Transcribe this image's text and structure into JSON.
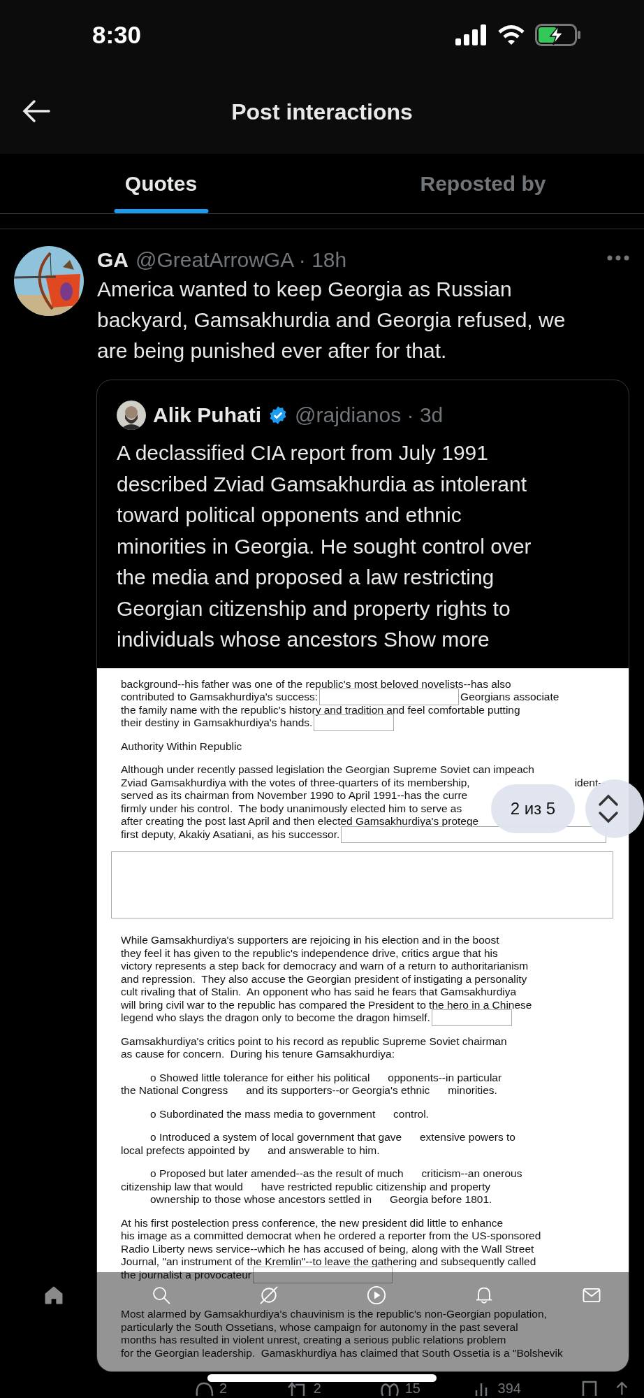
{
  "status_bar": {
    "time": "8:30"
  },
  "header": {
    "title": "Post interactions"
  },
  "tabs": [
    {
      "label": "Quotes",
      "selected": true
    },
    {
      "label": "Reposted by",
      "selected": false
    }
  ],
  "post": {
    "name": "GA",
    "meta": "@GreatArrowGA · 18h",
    "text_lines": [
      "America wanted to keep Georgia as Russian",
      "backyard, Gamsakhurdia and Georgia refused, we",
      "are being punished ever after for that."
    ],
    "quote": {
      "name": "Alik Puhati",
      "verified": true,
      "meta": "@rajdianos · 3d",
      "text_lines": [
        "A declassified CIA report from July 1991",
        "described Zviad Gamsakhurdia as intolerant",
        "toward political opponents and ethnic",
        "minorities in Georgia. He sought control over",
        "the media and proposed a law restricting",
        "Georgian citizenship and property rights to",
        "individuals whose ancestors"
      ],
      "show_more": "Show more",
      "document": {
        "blocks": [
          {
            "kind": "para",
            "lines": [
              {
                "text": "background--his father was one of the republic's most beloved novelists--has also",
                "kind": "plain"
              },
              {
                "text": "contributed to Gamsakhurdiya's success:",
                "kind": "medium",
                "tail": "Georgians associate"
              },
              {
                "text": "the family name with the republic's history and tradition and feel comfortable putting",
                "kind": "plain"
              },
              {
                "text": "their destiny in Gamsakhurdiya's hands.",
                "kind": "short"
              }
            ]
          },
          {
            "kind": "heading",
            "text": "Authority Within Republic"
          },
          {
            "kind": "para",
            "lines": [
              {
                "text": "Although under recently passed legislation the Georgian Supreme Soviet can impeach",
                "kind": "plain"
              },
              {
                "text": "Zviad Gamsakhurdiya with the votes of three-quarters of its membership,",
                "kind": "gap",
                "tail": "ident--"
              },
              {
                "text": "served as its chairman from November 1990 to April 1991--has the curre",
                "kind": "plain"
              },
              {
                "text": "firmly under his control.  The body unanimously elected him to serve as",
                "kind": "plain"
              },
              {
                "text": "after creating the post last April and then elected Gamsakhurdiya's protege",
                "kind": "plain"
              },
              {
                "text": "first deputy, Akakiy Asatiani, as his successor.",
                "kind": "wide"
              }
            ]
          },
          {
            "kind": "redacted_block"
          },
          {
            "kind": "para",
            "lines": [
              {
                "text": "While Gamsakhurdiya's supporters are rejoicing in his election and in the boost",
                "kind": "plain"
              },
              {
                "text": "they feel it has given to the republic's independence drive, critics argue that his",
                "kind": "plain"
              },
              {
                "text": "victory represents a step back for democracy and warn of a return to authoritarianism",
                "kind": "plain"
              },
              {
                "text": "and repression.  They also accuse the Georgian president of instigating a personality",
                "kind": "plain"
              },
              {
                "text": "cult rivaling that of Stalin.  An opponent who has said he fears that Gamsakhurdiya",
                "kind": "plain"
              },
              {
                "text": "will bring civil war to the republic has compared the President to the hero in a Chinese",
                "kind": "plain"
              },
              {
                "text": "legend who slays the dragon only to become the dragon himself.",
                "kind": "short"
              }
            ]
          },
          {
            "kind": "para",
            "lines": [
              {
                "text": "Gamsakhurdiya's critics point to his record as republic Supreme Soviet chairman",
                "kind": "plain"
              },
              {
                "text": "as cause for concern.  During his tenure Gamsakhurdiya:",
                "kind": "plain"
              }
            ]
          },
          {
            "kind": "para",
            "lines": [
              {
                "text": "o Showed little tolerance for either his political      opponents--in particular",
                "kind": "plain",
                "indent": true
              },
              {
                "text": "the National Congress      and its supporters--or Georgia's ethnic      minorities.",
                "kind": "plain",
                "indent": false
              }
            ]
          },
          {
            "kind": "para",
            "lines": [
              {
                "text": "o Subordinated the mass media to government      control.",
                "kind": "plain",
                "indent": true
              }
            ]
          },
          {
            "kind": "para",
            "lines": [
              {
                "text": "o Introduced a system of local government that gave      extensive powers to",
                "kind": "plain",
                "indent": true
              },
              {
                "text": "local prefects appointed by      and answerable to him.",
                "kind": "plain",
                "indent": false
              }
            ]
          },
          {
            "kind": "para",
            "lines": [
              {
                "text": "o Proposed but later amended--as the result of much      criticism--an onerous",
                "kind": "plain",
                "indent": true
              },
              {
                "text": "citizenship law that would      have restricted republic citizenship and property",
                "kind": "plain",
                "indent": false
              },
              {
                "text": "ownership to those whose ancestors settled in      Georgia before 1801.",
                "kind": "plain",
                "indent": true
              }
            ]
          },
          {
            "kind": "para",
            "lines": [
              {
                "text": "At his first postelection press conference, the new president did little to enhance",
                "kind": "plain"
              },
              {
                "text": "his image as a committed democrat when he ordered a reporter from the US-sponsored",
                "kind": "plain"
              },
              {
                "text": "Radio Liberty news service--which he has accused of being, along with the Wall Street",
                "kind": "plain"
              },
              {
                "text": "Journal, \"an instrument of the Kremlin\"--to leave the gathering and subsequently called",
                "kind": "plain"
              },
              {
                "text": "the journalist a provocateur",
                "kind": "medium"
              }
            ]
          },
          {
            "kind": "para",
            "lines": [
              {
                "text": "Most alarmed by Gamsakhurdiya's chauvinism is the republic's non-Georgian population,",
                "kind": "plain"
              },
              {
                "text": "particularly the South Ossetians, whose campaign for autonomy in the past several",
                "kind": "plain"
              },
              {
                "text": "months has resulted in violent unrest, creating a serious public relations problem",
                "kind": "plain"
              },
              {
                "text": "for the Georgian leadership.  Gamaskhurdiya has claimed that South Ossetia is a \"Bolshevik",
                "kind": "plain"
              }
            ]
          }
        ]
      },
      "pager": {
        "label": "2 из 5"
      }
    }
  },
  "nav": [
    {
      "selected": true
    },
    {
      "selected": false
    },
    {
      "selected": false
    },
    {
      "selected": false
    },
    {
      "selected": false
    },
    {
      "selected": false
    }
  ],
  "actions": [
    "2",
    "2",
    "15",
    "394"
  ]
}
